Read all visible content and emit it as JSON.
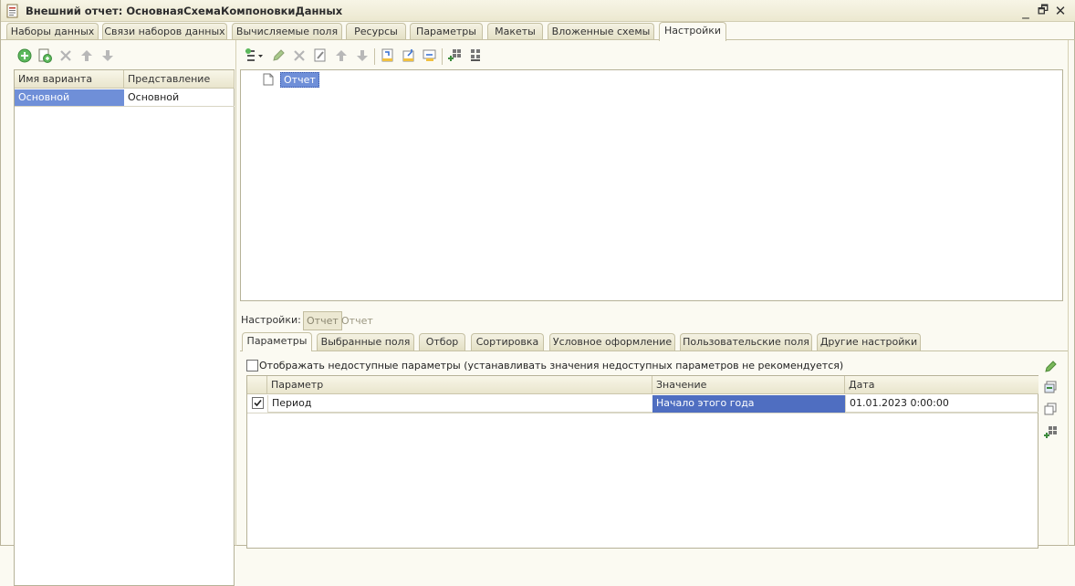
{
  "window": {
    "title": "Внешний отчет: ОсновнаяСхемаКомпоновкиДанных",
    "minimize": "_",
    "restore": "🗗",
    "close": "✕"
  },
  "top_tabs": [
    {
      "label": "Наборы данных"
    },
    {
      "label": "Связи наборов данных"
    },
    {
      "label": "Вычисляемые поля"
    },
    {
      "label": "Ресурсы"
    },
    {
      "label": "Параметры"
    },
    {
      "label": "Макеты"
    },
    {
      "label": "Вложенные схемы"
    },
    {
      "label": "Настройки",
      "active": true
    }
  ],
  "left_toolbar": {
    "icons": [
      "add-circle-icon",
      "copy-icon",
      "delete-icon",
      "move-up-icon",
      "move-down-icon"
    ]
  },
  "variants": {
    "columns": [
      "Имя варианта",
      "Представление"
    ],
    "rows": [
      {
        "name": "Основной",
        "presentation": "Основной"
      }
    ]
  },
  "tree": {
    "root_label": "Отчет"
  },
  "settings": {
    "label": "Настройки:",
    "current_chip": "Отчет",
    "current_text": "Отчет"
  },
  "sub_tabs": [
    {
      "label": "Параметры",
      "active": true
    },
    {
      "label": "Выбранные поля"
    },
    {
      "label": "Отбор"
    },
    {
      "label": "Сортировка"
    },
    {
      "label": "Условное оформление"
    },
    {
      "label": "Пользовательские поля"
    },
    {
      "label": "Другие настройки"
    }
  ],
  "params": {
    "show_unavailable_label": "Отображать недоступные параметры (устанавливать значения недоступных параметров не рекомендуется)",
    "show_unavailable_checked": false,
    "columns": [
      "Параметр",
      "Значение",
      "Дата"
    ],
    "rows": [
      {
        "checked": true,
        "parameter": "Период",
        "value": "Начало этого года",
        "date": "01.01.2023 0:00:00"
      }
    ]
  },
  "colors": {
    "background": "#fbfaf2",
    "selection": "#6f8fd8",
    "value_selection": "#4f6ec1",
    "border": "#b6b298"
  }
}
